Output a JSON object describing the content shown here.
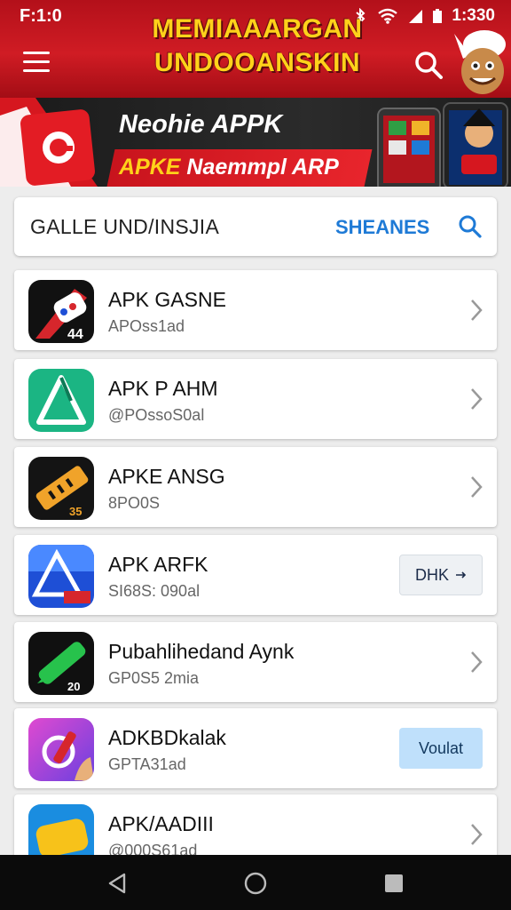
{
  "status_bar": {
    "time": "F:1:0",
    "clock": "1:330"
  },
  "header": {
    "title_line1": "MEMIAAARGAN",
    "title_line2": "UNDOOANSKIN"
  },
  "banner": {
    "line1": "Neohie APPK",
    "line2_highlight": "APKE",
    "line2_rest": "Naemmpl ARP"
  },
  "search": {
    "label": "GALLE  UND/INSJIA",
    "action_label": "SHEANES"
  },
  "apps": [
    {
      "name": "APK  GASNE",
      "sub": "APOss1ad",
      "button": "",
      "icon_colors": [
        "#111111",
        "#d6262c"
      ]
    },
    {
      "name": "APK P AHM",
      "sub": "@POssoS0al",
      "button": "",
      "icon_colors": [
        "#17b07a",
        "#3fd3a3"
      ]
    },
    {
      "name": "APKE ANSG",
      "sub": "8PO0S",
      "button": "",
      "icon_colors": [
        "#141414",
        "#f0a32a"
      ]
    },
    {
      "name": "APK  ARFK",
      "sub": "SI68S: 090al",
      "button": "DHK",
      "icon_colors": [
        "#1e4fd6",
        "#4a89ff"
      ]
    },
    {
      "name": "Pubahlihedand Aynk",
      "sub": "GP0S5 2mia",
      "button": "",
      "icon_colors": [
        "#101010",
        "#27c24c"
      ]
    },
    {
      "name": "ADKBDkalak",
      "sub": "GPTA31ad",
      "button": "Voulat",
      "icon_colors": [
        "#d03cc8",
        "#7a4ae6"
      ]
    },
    {
      "name": "APK/AADIII",
      "sub": "@000S61ad",
      "button": "",
      "icon_colors": [
        "#1a8de0",
        "#f7c21a"
      ]
    }
  ],
  "colors": {
    "header_red": "#c4141d",
    "accent_blue": "#1e7ad6",
    "title_yellow": "#ffd21a"
  }
}
